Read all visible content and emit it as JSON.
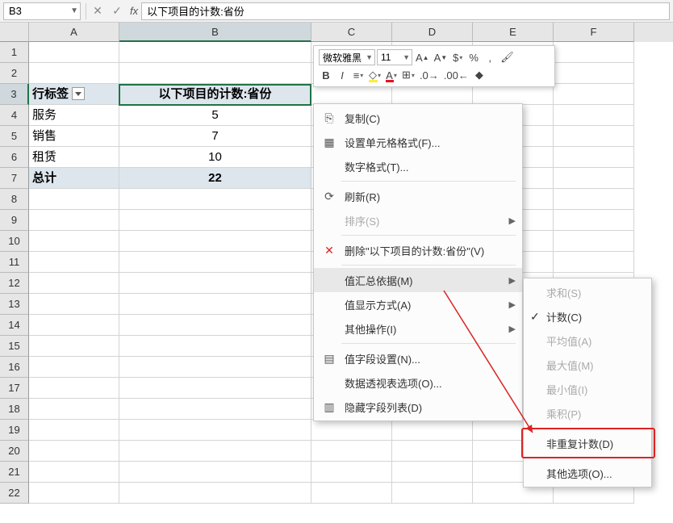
{
  "name_box": "B3",
  "formula": "以下项目的计数:省份",
  "columns": [
    "A",
    "B",
    "C",
    "D",
    "E",
    "F"
  ],
  "rows_shown": 22,
  "pivot": {
    "header_row_label": "行标签",
    "header_value_label": "以下项目的计数:省份",
    "rows": [
      {
        "label": "服务",
        "value": "5"
      },
      {
        "label": "销售",
        "value": "7"
      },
      {
        "label": "租赁",
        "value": "10"
      }
    ],
    "total_label": "总计",
    "total_value": "22"
  },
  "mini_toolbar": {
    "font": "微软雅黑",
    "size": "11",
    "percent": "%",
    "comma": ","
  },
  "context_menu": {
    "copy": "复制(C)",
    "format_cells": "设置单元格格式(F)...",
    "number_format": "数字格式(T)...",
    "refresh": "刷新(R)",
    "sort": "排序(S)",
    "delete_field": "删除\"以下项目的计数:省份\"(V)",
    "summarize_by": "值汇总依据(M)",
    "show_values_as": "值显示方式(A)",
    "other_actions": "其他操作(I)",
    "field_settings": "值字段设置(N)...",
    "pivot_options": "数据透视表选项(O)...",
    "hide_field_list": "隐藏字段列表(D)"
  },
  "submenu": {
    "sum": "求和(S)",
    "count": "计数(C)",
    "average": "平均值(A)",
    "max": "最大值(M)",
    "min": "最小值(I)",
    "product": "乘积(P)",
    "distinct_count": "非重复计数(D)",
    "more": "其他选项(O)..."
  }
}
